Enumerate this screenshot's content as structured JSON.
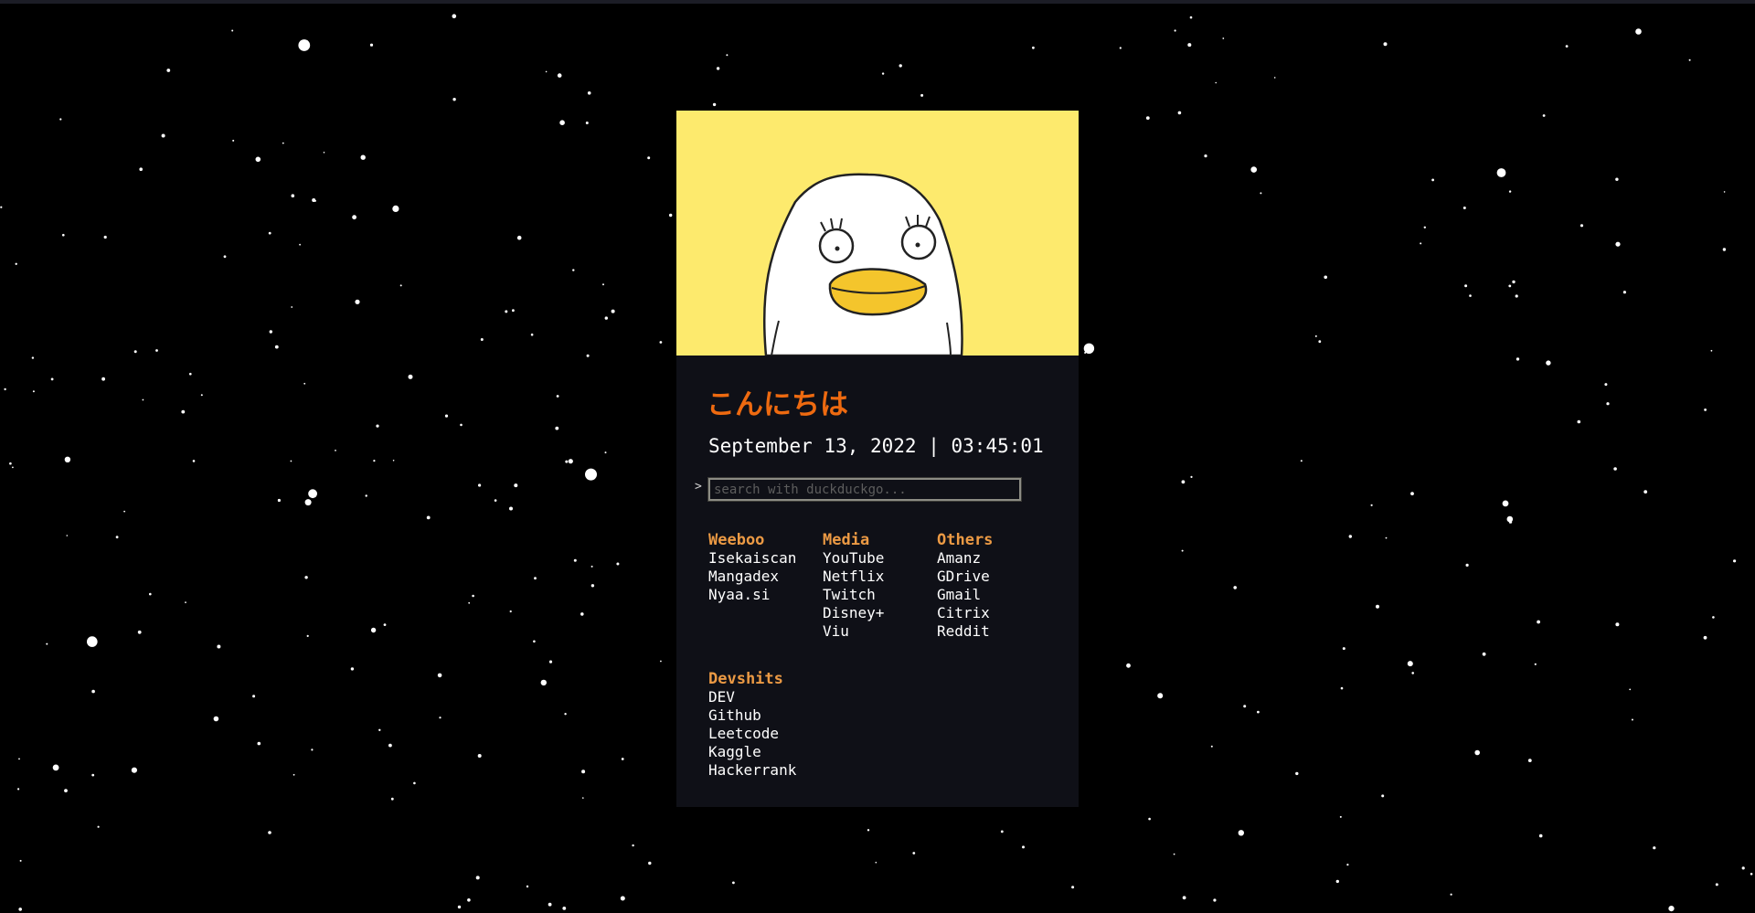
{
  "greeting": "こんにちは",
  "datetime": "September 13, 2022 | 03:45:01",
  "search": {
    "prompt": ">",
    "placeholder": "search with duckduckgo..."
  },
  "groups": [
    {
      "title": "Weeboo",
      "links": [
        "Isekaiscan",
        "Mangadex",
        "Nyaa.si"
      ]
    },
    {
      "title": "Media",
      "links": [
        "YouTube",
        "Netflix",
        "Twitch",
        "Disney+",
        "Viu"
      ]
    },
    {
      "title": "Others",
      "links": [
        "Amanz",
        "GDrive",
        "Gmail",
        "Citrix",
        "Reddit"
      ]
    },
    {
      "title": "Devshits",
      "links": [
        "DEV",
        "Github",
        "Leetcode",
        "Kaggle",
        "Hackerrank"
      ]
    }
  ],
  "colors": {
    "background": "#000000",
    "card": "#0f1017",
    "banner": "#fdea6d",
    "greeting": "#ee6a10",
    "group_title": "#ec9a44",
    "text": "#ffffff"
  }
}
